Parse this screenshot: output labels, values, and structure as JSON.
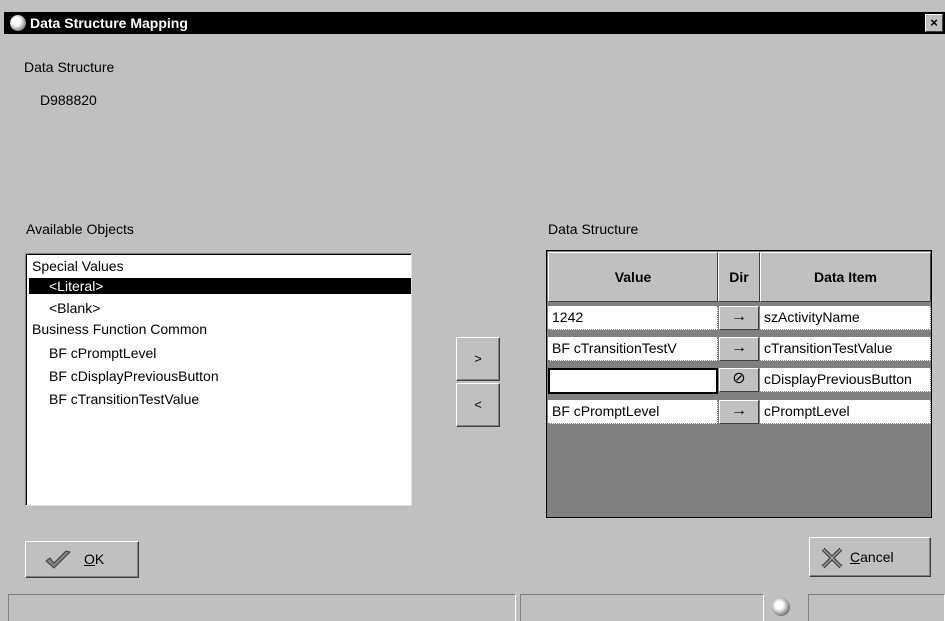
{
  "window": {
    "title": "Data Structure Mapping",
    "close_label": "×"
  },
  "header": {
    "section_label": "Data Structure",
    "structure_name": "D988820"
  },
  "available": {
    "label": "Available Objects",
    "items": [
      {
        "text": "Special Values"
      },
      {
        "text": "<Literal>"
      },
      {
        "text": "<Blank>"
      },
      {
        "text": "Business Function Common"
      },
      {
        "text": "BF  cPromptLevel"
      },
      {
        "text": "BF  cDisplayPreviousButton"
      },
      {
        "text": "BF  cTransitionTestValue"
      }
    ],
    "selected_index": 1
  },
  "transfer": {
    "add_label": ">",
    "remove_label": "<"
  },
  "mapping": {
    "label": "Data Structure",
    "columns": [
      "Value",
      "Dir",
      "Data Item"
    ],
    "rows": [
      {
        "value": "1242",
        "dir": "→",
        "data_item": "szActivityName"
      },
      {
        "value": "BF cTransitionTestV",
        "dir": "→",
        "data_item": "cTransitionTestValue"
      },
      {
        "value": "",
        "dir": "⊘",
        "data_item": "cDisplayPreviousButton"
      },
      {
        "value": "BF cPromptLevel",
        "dir": "→",
        "data_item": "cPromptLevel"
      }
    ]
  },
  "buttons": {
    "ok_label": "OK",
    "ok_mnemonic": "O",
    "ok_rest": "K",
    "cancel_mnemonic": "C",
    "cancel_rest": "ancel"
  },
  "status": {
    "globe_icon": "globe-icon"
  }
}
